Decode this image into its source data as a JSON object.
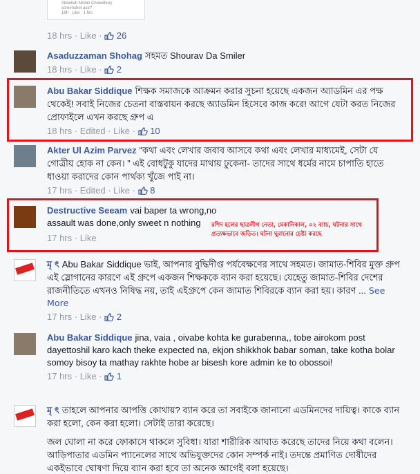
{
  "shared_preview": {
    "author": "Abdullah Mobin Chowdhury",
    "caption": "screenshot ase?",
    "meta": "18h · Like · 1 hrs"
  },
  "comments": [
    {
      "meta": {
        "time": "18 hrs",
        "like": "Like",
        "count": "26"
      }
    },
    {
      "name": "Asaduzzaman Shohag",
      "text": "সহমত Shourav Da Smiler",
      "meta": {
        "time": "18 hrs",
        "like": "Like",
        "count": "2"
      }
    },
    {
      "name": "Abu Bakar Siddique",
      "text": "শিক্ষক সমাজকে আক্রমন করার সুচনা হয়েছে একজন অ্যাডমিন এর পক্ষ থেকেই! সবাই নিজের চেতনা বাস্তবায়ন করছে অ্যাডমিন হিসেবে কাজ করে! আগে যেটা করত নিজের প্রোফাইলে এখন করছে গ্রুপ এ",
      "meta": {
        "time": "18 hrs",
        "edited": "Edited",
        "like": "Like",
        "count": "10"
      }
    },
    {
      "name": "Akter Ul Azim Parvez",
      "text": "“কথা এবং লেখার জবাব আসবে কথা এবং লেখার মাধ্যমেই, সেটা যে গোত্রীয় হোক না কেন। ” এই বোধটুকু যাদের মাথায় ঢুকেনা- তাদের সাথে ধর্মের নামে চাপাতি হাতে ধাওয়া করাদের কোন পার্থক্য খুঁজে পাই না।",
      "meta": {
        "time": "17 hrs",
        "edited": "Edited",
        "like": "Like",
        "count": "8"
      }
    },
    {
      "name": "Destructive Seeam",
      "text": "vai baper ta wrong,no assault was done,only sweet n nothing",
      "meta": {
        "time": "17 hrs",
        "like": "Like"
      }
    },
    {
      "name": "মৃ ৎ",
      "text": "Abu Bakar Siddique ভাই, আপনার বুদ্ধিদীপ্ত পর্যবেক্ষণের সাথে সহমত। জামাত-শিবির মুক্ত গ্রুপ এই স্লোগানের কারণে এই গ্রুপে একজন শিক্ষককে ব্যান করা হয়েছে। যেহেতু জামাত-শিবির দেশের রাজনীতিতে এখনও নিষিদ্ধ নয়, তাই এইগ্রুপে কেন জামাত শিবিরকে ব্যান করা হয়। কারণ ...",
      "see_more": "See More",
      "meta": {
        "time": "17 hrs",
        "like": "Like",
        "count": "2"
      }
    },
    {
      "name": "Abu Bakar Siddique",
      "text": "jina, vaia , oivabe kohta ke gurabenna,, tobe airokom post dayettoshil karo kach theke expected na, ekjon shikkhok babar soman, take kotha bolar somoy bisoy ta mathay rakhte hobe ar bisesh kore admin ke to obossoi!",
      "meta": {
        "time": "17 hrs",
        "like": "Like",
        "count": "1"
      }
    },
    {
      "name": "মৃ ৎ",
      "text": "তাহলে আপনার আপত্তি কোথায়? ব্যান করে তা সবাইকে জানানো এডমিনদের দায়িত্ব। কাকে ব্যান করা হলো, কেন করা হলো। সেটাই তারা করেছে।",
      "text2": "জল ঘোলা না করে ফোকাসে থাকলে সুবিধা। যারা শারীরিক আঘাত করেছে তাদের নিয়ে কথা বলেন। আড়িপাতার এডমিন প্যানেলের সাথে অভিযুক্তদের কোন সম্পর্ক নাই। তদন্তে প্রমাণিত দোষীদের একইভাবে ঘোষণা দিয়ে ব্যান করা হবে তা অনেক আগেই বলা হয়েছে।"
    }
  ],
  "annotation": "রশিদ হলের ছাত্রলীগ নেতা, মেকানিকাল, ০২ ব্যাচ, ঘটনার সাথে প্রত্যক্ষভাবে জড়িত। ঘটনা ঘুরানোর চেষ্টা করছে",
  "colors": {
    "link": "#3b5998",
    "meta": "#9197a3",
    "highlight": "#e8111a"
  },
  "icons": [
    "thumbs-up-icon",
    "avatar-image"
  ]
}
